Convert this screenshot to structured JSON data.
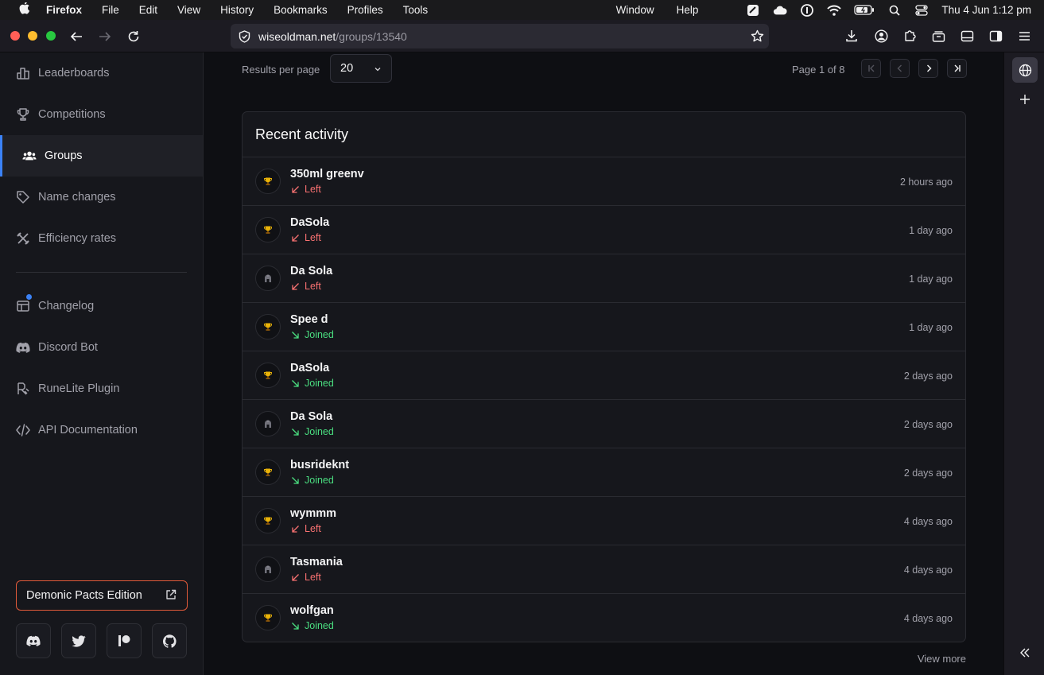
{
  "menubar": {
    "app_name": "Firefox",
    "items": [
      "File",
      "Edit",
      "View",
      "History",
      "Bookmarks",
      "Profiles",
      "Tools"
    ],
    "right_items": [
      "Window",
      "Help"
    ],
    "clock": "Thu 4 Jun  1:12 pm"
  },
  "browser": {
    "url_host": "wiseoldman.net",
    "url_path": "/groups/13540"
  },
  "sidebar": {
    "items": [
      {
        "label": "Leaderboards",
        "icon": "bar-chart-icon"
      },
      {
        "label": "Competitions",
        "icon": "trophy-icon"
      },
      {
        "label": "Groups",
        "icon": "users-icon"
      },
      {
        "label": "Name changes",
        "icon": "tag-icon"
      },
      {
        "label": "Efficiency rates",
        "icon": "tools-icon"
      }
    ],
    "secondary_items": [
      {
        "label": "Changelog",
        "icon": "changelog-icon"
      },
      {
        "label": "Discord Bot",
        "icon": "discord-icon"
      },
      {
        "label": "RuneLite Plugin",
        "icon": "runelite-icon"
      },
      {
        "label": "API Documentation",
        "icon": "code-icon"
      }
    ],
    "promo_label": "Demonic Pacts Edition",
    "social_icons": [
      "discord-icon",
      "twitter-icon",
      "patreon-icon",
      "github-icon"
    ]
  },
  "pagination": {
    "results_label": "Results per page",
    "results_value": "20",
    "page_info": "Page 1 of 8"
  },
  "activity": {
    "title": "Recent activity",
    "rows": [
      {
        "name": "350ml greenv",
        "type": "Left",
        "time": "2 hours ago",
        "icon": "trophy"
      },
      {
        "name": "DaSola",
        "type": "Left",
        "time": "1 day ago",
        "icon": "trophy"
      },
      {
        "name": "Da Sola",
        "type": "Left",
        "time": "1 day ago",
        "icon": "helmet"
      },
      {
        "name": "Spee d",
        "type": "Joined",
        "time": "1 day ago",
        "icon": "trophy"
      },
      {
        "name": "DaSola",
        "type": "Joined",
        "time": "2 days ago",
        "icon": "trophy"
      },
      {
        "name": "Da Sola",
        "type": "Joined",
        "time": "2 days ago",
        "icon": "helmet"
      },
      {
        "name": "busrideknt",
        "type": "Joined",
        "time": "2 days ago",
        "icon": "trophy"
      },
      {
        "name": "wymmm",
        "type": "Left",
        "time": "4 days ago",
        "icon": "trophy"
      },
      {
        "name": "Tasmania",
        "type": "Left",
        "time": "4 days ago",
        "icon": "helmet"
      },
      {
        "name": "wolfgan",
        "type": "Joined",
        "time": "4 days ago",
        "icon": "trophy"
      }
    ],
    "view_more": "View more"
  },
  "colors": {
    "accent": "#3b82f6",
    "left": "#f87171",
    "joined": "#4ade80",
    "promo_border": "#e15a3a"
  }
}
